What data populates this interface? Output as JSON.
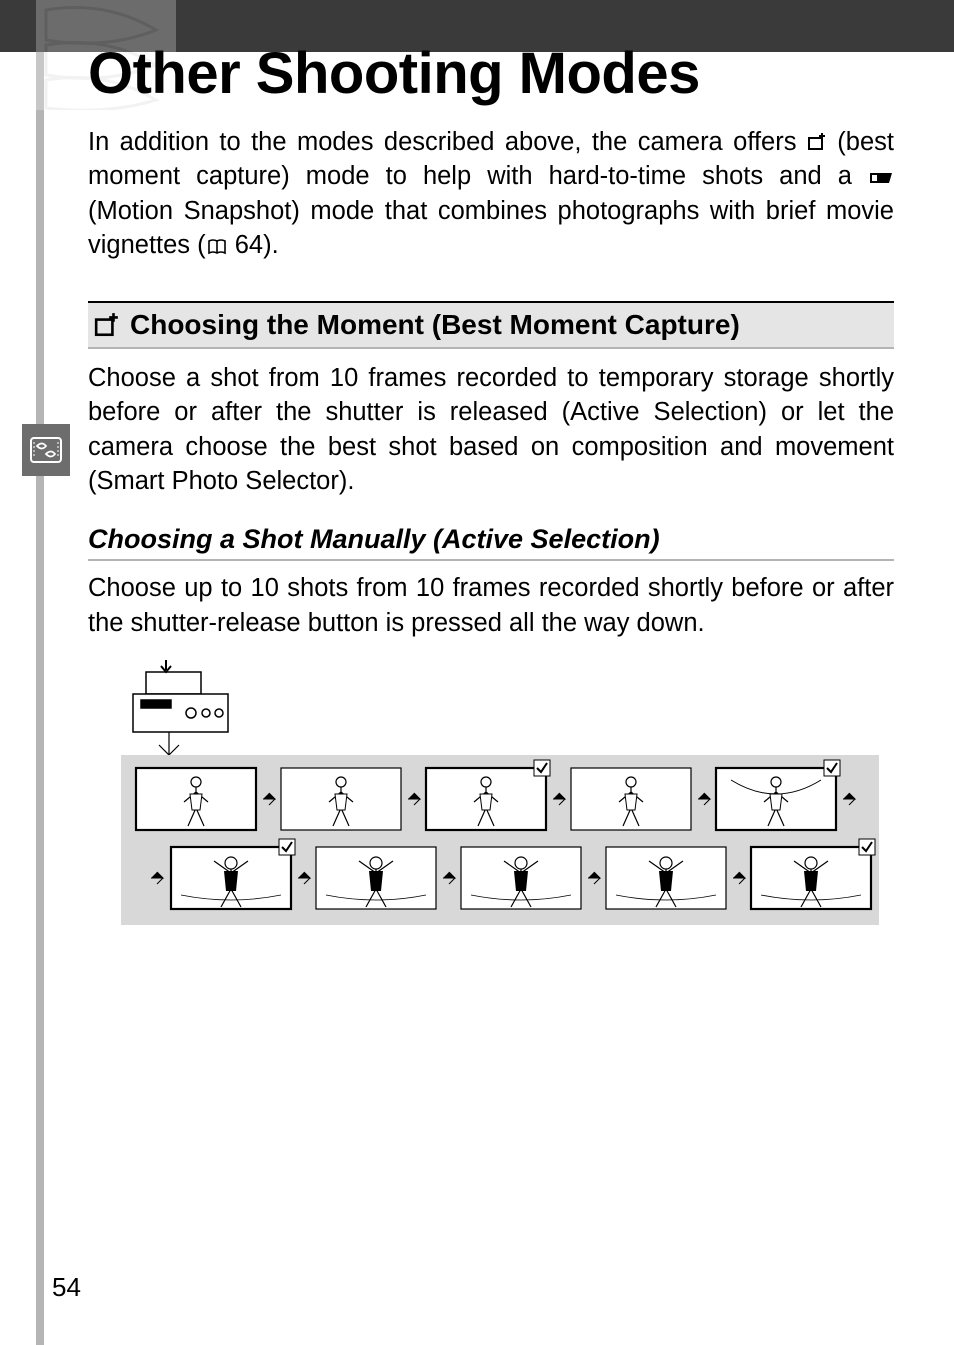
{
  "page_number": "54",
  "title": "Other Shooting Modes",
  "intro_parts": {
    "p1": "In addition to the modes described above, the camera offers ",
    "p2": " (best moment capture) mode to help with hard-to-time shots and a ",
    "p3": " (Motion Snapshot) mode that combines photographs with brief movie vignettes (",
    "p4": " 64)."
  },
  "section": {
    "heading": "Choosing the Moment (Best Moment Capture)",
    "body": "Choose a shot from 10 frames recorded to temporary storage shortly before or after the shutter is released (Active Selection) or let the camera choose the best shot based on composition and movement (Smart Photo Selector)."
  },
  "subsection": {
    "heading": "Choosing a Shot Manually (Active Selection)",
    "body": "Choose up to 10 shots from 10 frames recorded shortly before or after the shutter-release button is pressed all the way down."
  },
  "icons": {
    "bmc": "best-moment-capture-icon",
    "motion": "motion-snapshot-icon",
    "book": "page-ref-icon",
    "side": "mode-tab-icon"
  }
}
